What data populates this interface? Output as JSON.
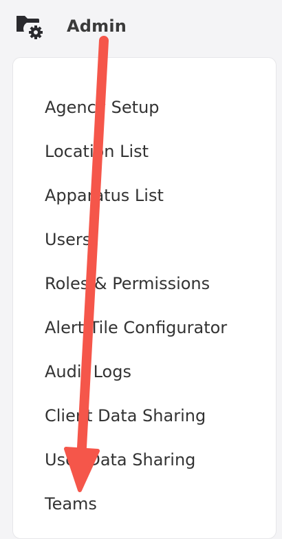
{
  "header": {
    "title": "Admin",
    "icon": "folder-gear-icon"
  },
  "menu": {
    "items": [
      {
        "label": "Agency Setup"
      },
      {
        "label": "Location List"
      },
      {
        "label": "Apparatus List"
      },
      {
        "label": "Users"
      },
      {
        "label": "Roles & Permissions"
      },
      {
        "label": "Alert Tile Configurator"
      },
      {
        "label": "Audit Logs"
      },
      {
        "label": "Client Data Sharing"
      },
      {
        "label": "User Data Sharing"
      },
      {
        "label": "Teams"
      }
    ]
  },
  "annotation": {
    "type": "arrow",
    "color": "#f5564a",
    "points_to": "Teams"
  },
  "colors": {
    "background": "#f4f4f6",
    "card": "#ffffff",
    "text": "#333333",
    "arrow": "#f5564a"
  }
}
